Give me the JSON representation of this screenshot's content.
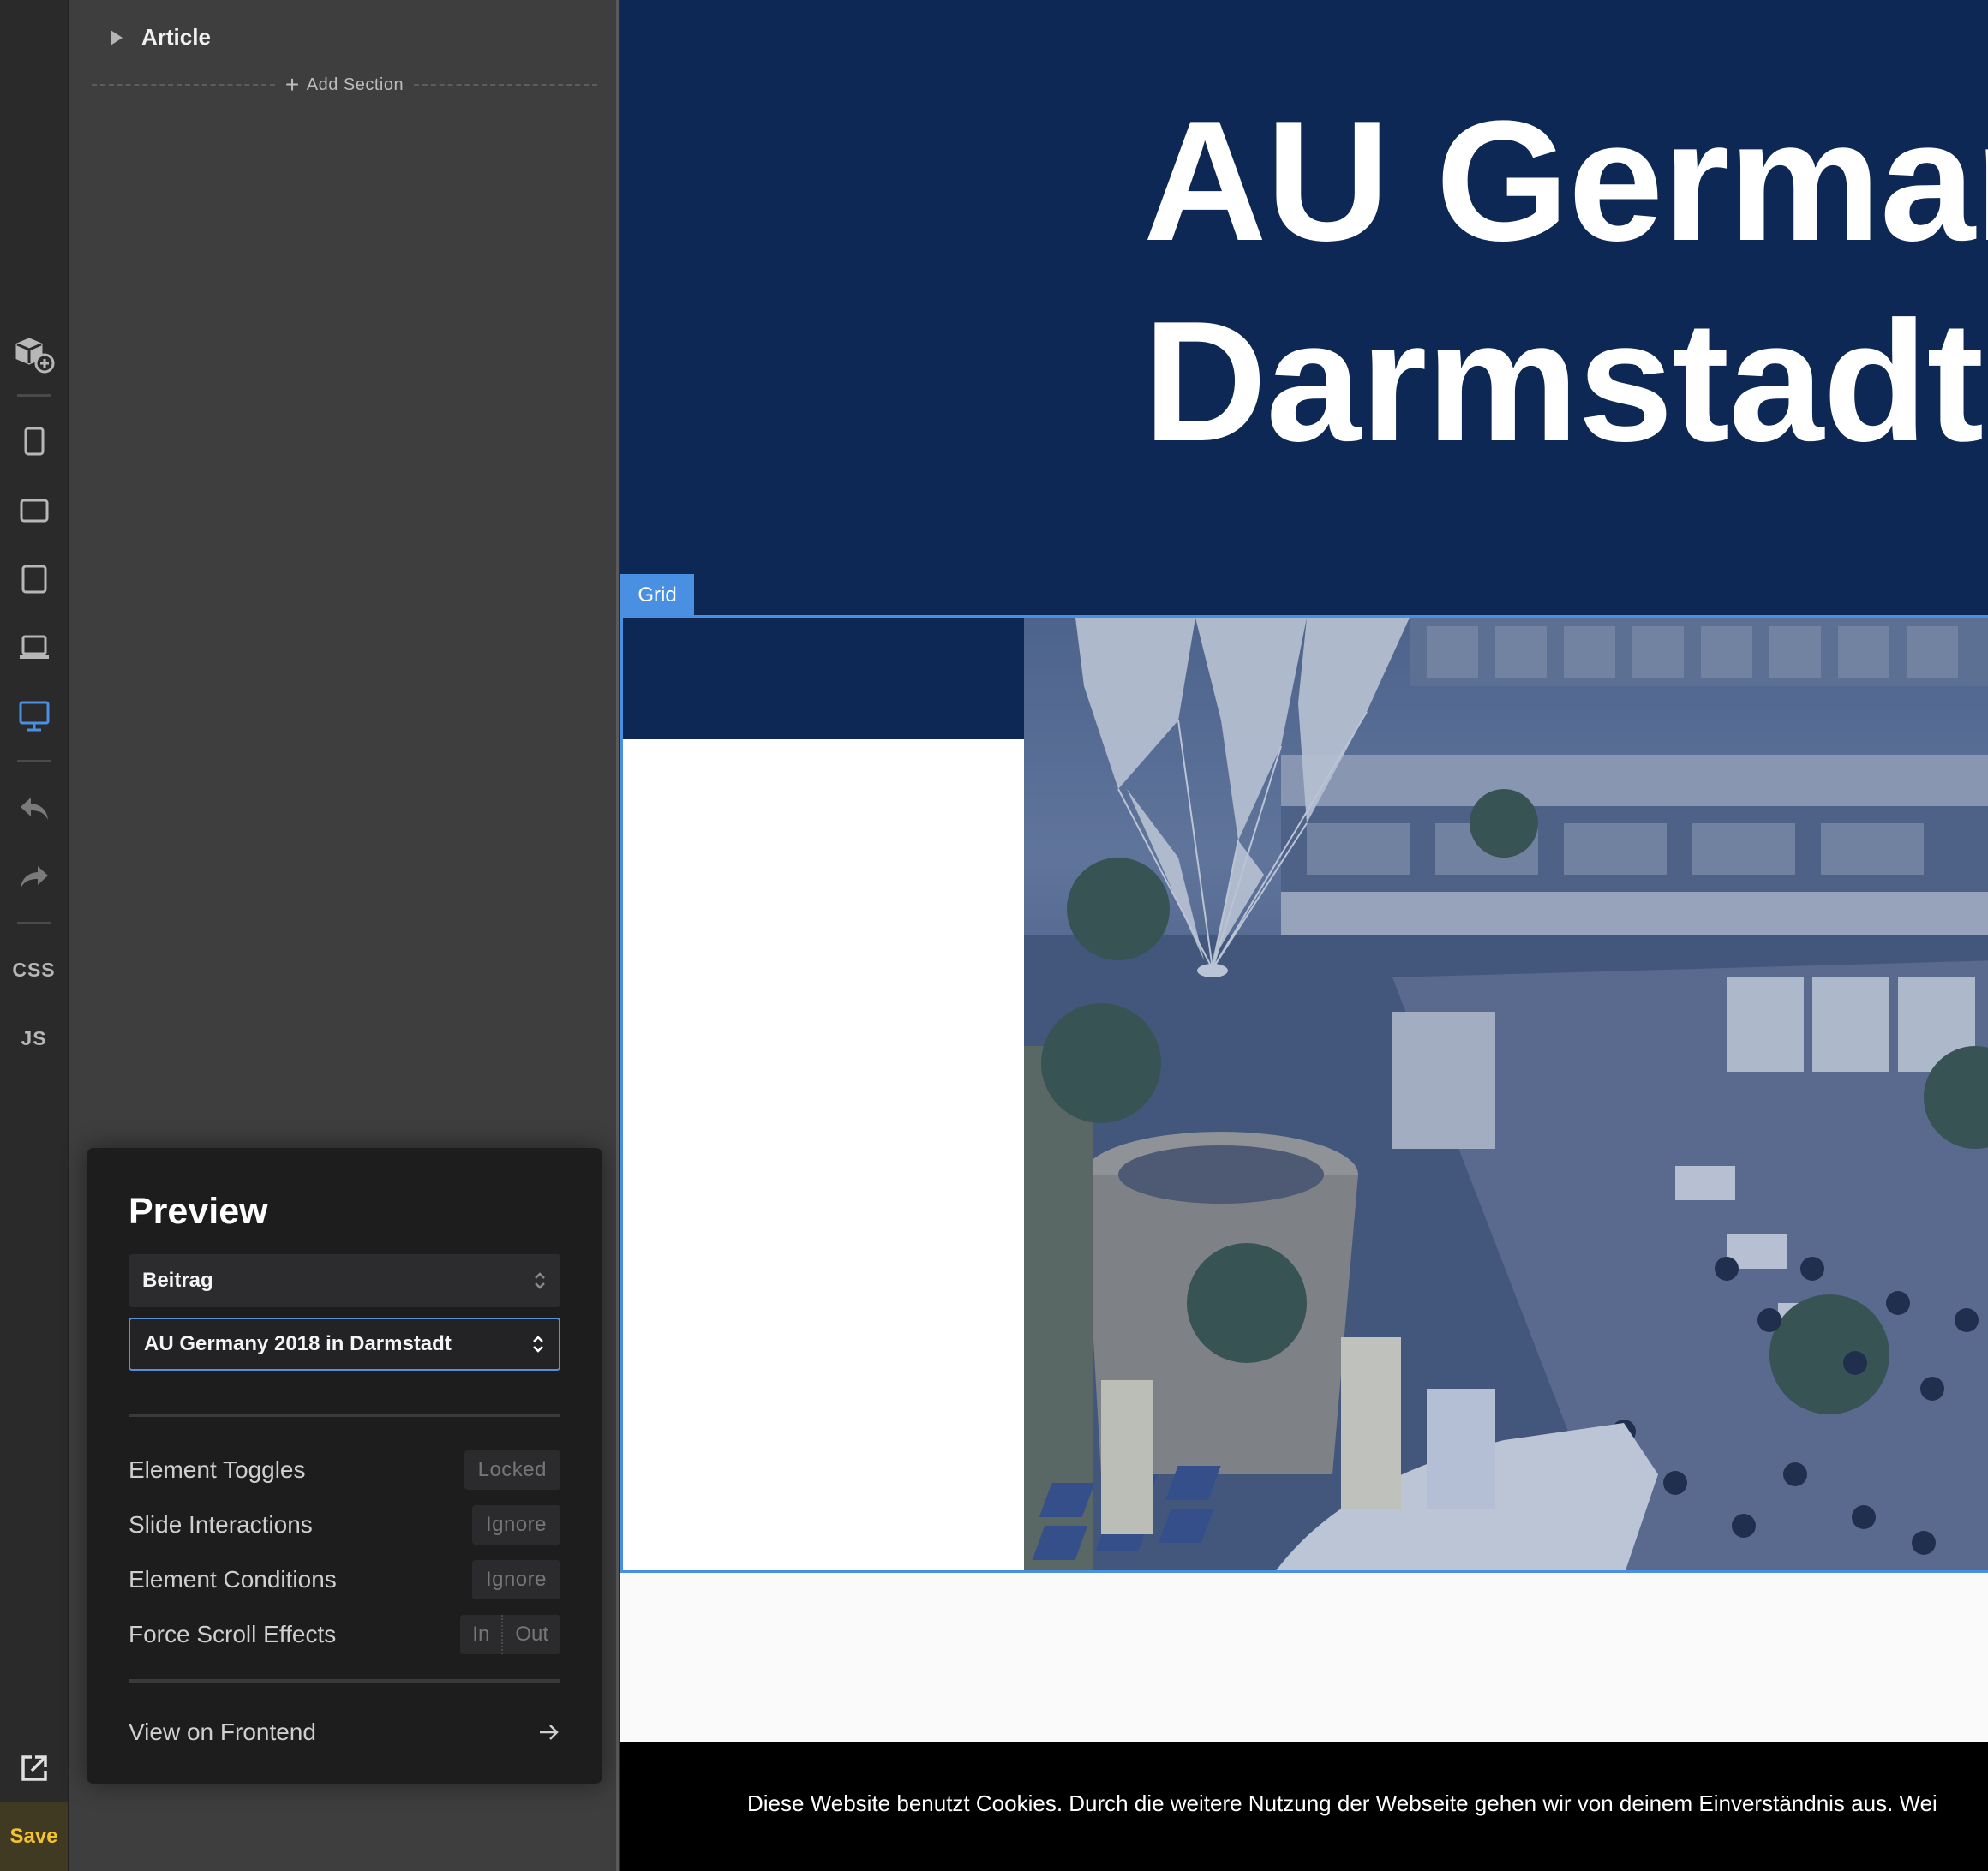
{
  "toolbar": {
    "items": [
      {
        "name": "add-element",
        "icon": "cube-plus-icon"
      },
      {
        "name": "mobile-portrait",
        "icon": "mobile-portrait-icon"
      },
      {
        "name": "mobile-landscape",
        "icon": "mobile-landscape-icon"
      },
      {
        "name": "tablet",
        "icon": "tablet-icon"
      },
      {
        "name": "laptop",
        "icon": "laptop-icon"
      },
      {
        "name": "desktop",
        "icon": "desktop-icon",
        "active": true
      },
      {
        "name": "undo",
        "icon": "undo-icon"
      },
      {
        "name": "redo",
        "icon": "redo-icon"
      }
    ],
    "css_label": "CSS",
    "js_label": "JS",
    "save_label": "Save",
    "accent_active": "#4a90e2",
    "save_color": "#f2c230"
  },
  "structure": {
    "article_label": "Article",
    "add_section_label": "Add Section"
  },
  "preview": {
    "title": "Preview",
    "post_type": "Beitrag",
    "post": "AU Germany 2018 in Darmstadt",
    "rows": [
      {
        "label": "Element Toggles",
        "value": "Locked"
      },
      {
        "label": "Slide Interactions",
        "value": "Ignore"
      },
      {
        "label": "Element Conditions",
        "value": "Ignore"
      },
      {
        "label": "Force Scroll Effects",
        "value_in": "In",
        "value_out": "Out"
      }
    ],
    "view_frontend_label": "View on Frontend"
  },
  "canvas": {
    "hero_line1": "AU German",
    "hero_line2": "Darmstadt",
    "grid_badge": "Grid",
    "cookie_text": "Diese Website benutzt Cookies. Durch die weitere Nutzung der Webseite gehen wir von deinem Einverständnis aus. Wei",
    "hero_bg": "#0e2855",
    "selection_color": "#4a90e2"
  }
}
